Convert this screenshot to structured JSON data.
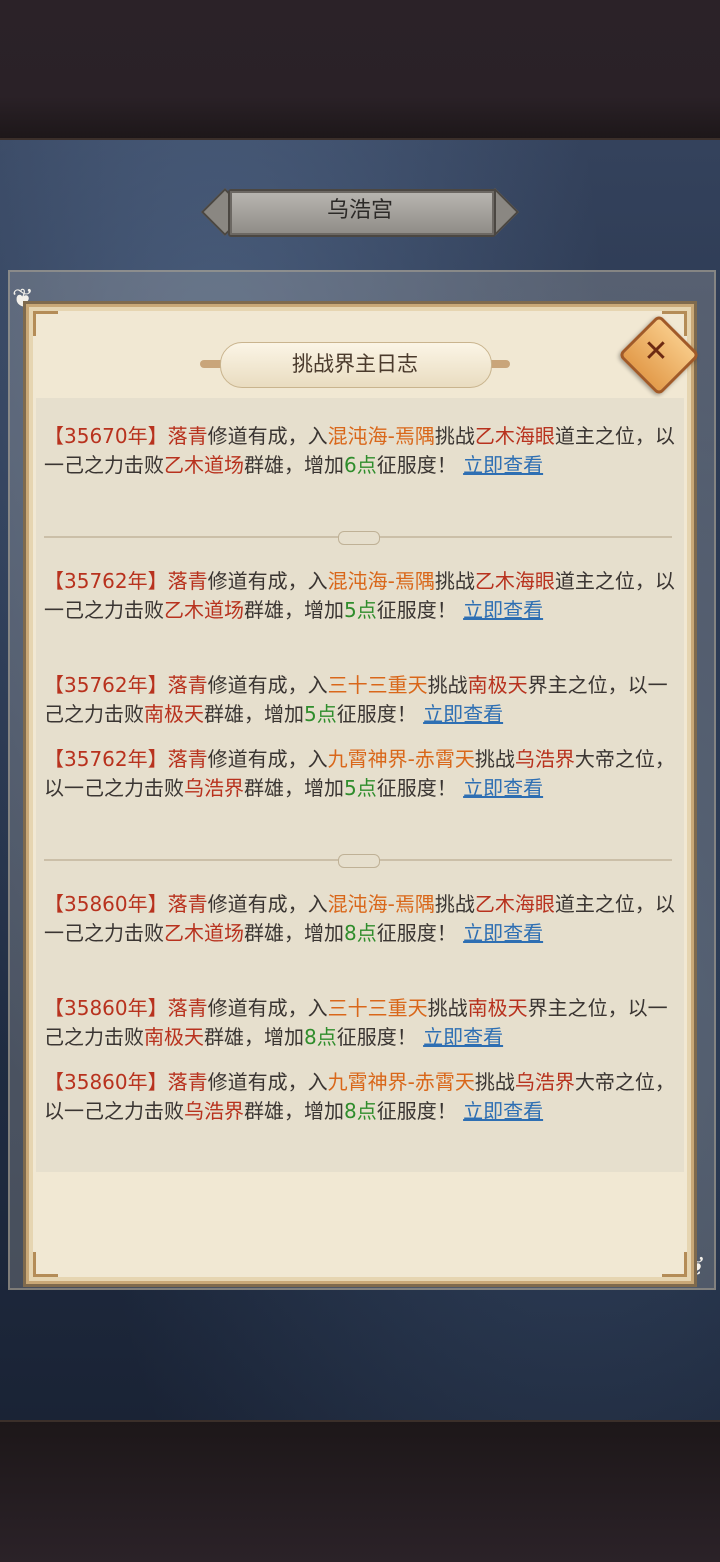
{
  "palace_title": "乌浩宫",
  "dialog": {
    "title": "挑战界主日志",
    "close_icon": "close-icon",
    "close_glyph": "✕"
  },
  "common": {
    "open_bracket": "【",
    "close_bracket": "】",
    "player": "落青",
    "mid1": "修道有成，入",
    "challenge": "挑战",
    "defeat": "以一己之力击败",
    "heroes": "群雄，增加",
    "point_suffix": "点",
    "submission": "征服度！",
    "link": "立即查看"
  },
  "entries": [
    {
      "year": "35670年",
      "realm": "混沌海-焉隅",
      "target": "乙木海眼",
      "role": "道主之位，",
      "venue": "乙木道场",
      "points": "6"
    },
    {
      "year": "35762年",
      "realm": "混沌海-焉隅",
      "target": "乙木海眼",
      "role": "道主之位，",
      "venue": "乙木道场",
      "points": "5"
    },
    {
      "year": "35762年",
      "realm": "三十三重天",
      "target": "南极天",
      "role": "界主之位，",
      "venue": "南极天",
      "points": "5"
    },
    {
      "year": "35762年",
      "realm": "九霄神界-赤霄天",
      "target": "乌浩界",
      "role": "大帝之位，",
      "venue": "乌浩界",
      "points": "5"
    },
    {
      "year": "35860年",
      "realm": "混沌海-焉隅",
      "target": "乙木海眼",
      "role": "道主之位，",
      "venue": "乙木道场",
      "points": "8"
    },
    {
      "year": "35860年",
      "realm": "三十三重天",
      "target": "南极天",
      "role": "界主之位，",
      "venue": "南极天",
      "points": "8"
    },
    {
      "year": "35860年",
      "realm": "九霄神界-赤霄天",
      "target": "乌浩界",
      "role": "大帝之位，",
      "venue": "乌浩界",
      "points": "8"
    }
  ]
}
